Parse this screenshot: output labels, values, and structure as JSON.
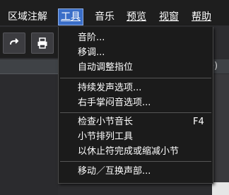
{
  "menubar": {
    "items": [
      {
        "label": "区域注解"
      },
      {
        "label": "工具",
        "active": true
      },
      {
        "label": "音乐"
      },
      {
        "label": "预览"
      },
      {
        "label": "视窗"
      },
      {
        "label": "帮助"
      }
    ]
  },
  "toolbar": {
    "redo_icon": "redo-arrow-icon",
    "print_icon": "printer-icon"
  },
  "tab_strip": {
    "partial_text": "re)"
  },
  "tools_menu": {
    "items": [
      {
        "label": "音阶..."
      },
      {
        "label": "移调..."
      },
      {
        "label": "自动调整指位"
      },
      {
        "label": "持续发声选项..."
      },
      {
        "label": "右手掌闷音选项..."
      },
      {
        "label": "检查小节音长",
        "shortcut": "F4"
      },
      {
        "label": "小节排列工具"
      },
      {
        "label": "以休止符完成或缩减小节"
      },
      {
        "label": "移动／互换声部..."
      }
    ]
  }
}
